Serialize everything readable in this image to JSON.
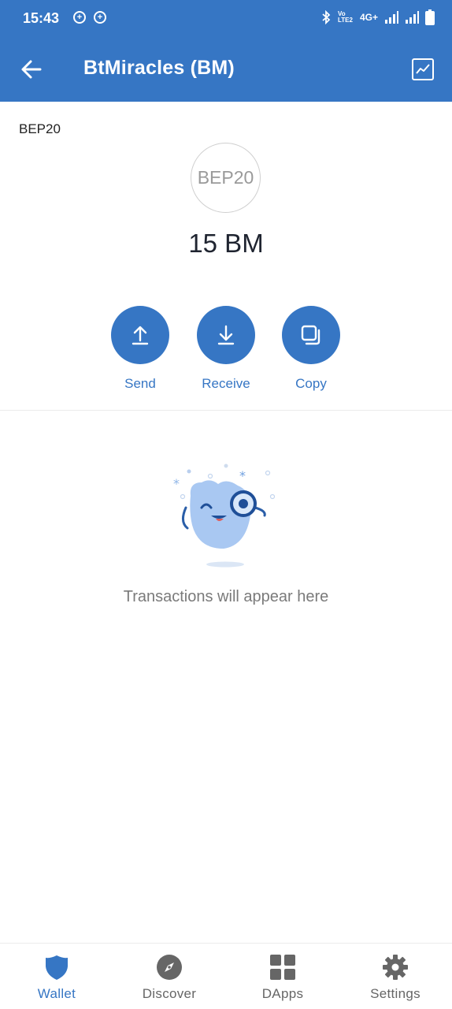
{
  "status_bar": {
    "time": "15:43",
    "network_type": "4G+",
    "volte_label": "Vo LTE2"
  },
  "app_bar": {
    "title": "BtMiracles (BM)",
    "back_icon": "arrow-left-icon",
    "chart_icon": "chart-icon"
  },
  "token": {
    "network": "BEP20",
    "logo_text": "BEP20",
    "balance": "15 BM"
  },
  "actions": [
    {
      "label": "Send",
      "icon": "upload-icon"
    },
    {
      "label": "Receive",
      "icon": "download-icon"
    },
    {
      "label": "Copy",
      "icon": "copy-icon"
    }
  ],
  "empty_state": {
    "message": "Transactions will appear here"
  },
  "bottom_nav": [
    {
      "label": "Wallet",
      "icon": "shield-icon",
      "active": true
    },
    {
      "label": "Discover",
      "icon": "compass-icon",
      "active": false
    },
    {
      "label": "DApps",
      "icon": "grid-icon",
      "active": false
    },
    {
      "label": "Settings",
      "icon": "gear-icon",
      "active": false
    }
  ],
  "colors": {
    "primary": "#3676c4",
    "text_muted": "#7a7a7a",
    "nav_inactive": "#666666"
  }
}
